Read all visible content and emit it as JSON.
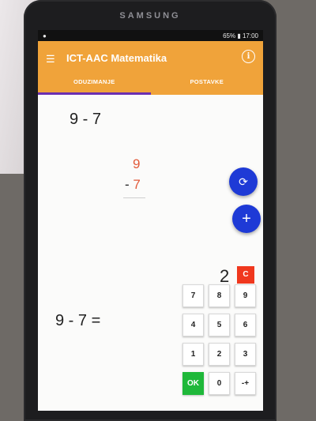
{
  "device": {
    "brand": "SAMSUNG"
  },
  "statusbar": {
    "battery": "65%",
    "time": "17:00"
  },
  "appbar": {
    "title": "ICT-AAC Matematika",
    "menu_icon": "hamburger-icon",
    "info_icon": "info-icon"
  },
  "tabs": [
    {
      "label": "ODUZIMANJE",
      "active": true
    },
    {
      "label": "POSTAVKE",
      "active": false
    }
  ],
  "task": {
    "top_expression": "9 - 7",
    "minuend": "9",
    "minus_sign": "- ",
    "subtrahend": "7",
    "bottom_expression": "9 - 7 ="
  },
  "answer": {
    "value": "2",
    "clear_label": "C"
  },
  "fabs": {
    "refresh_icon": "refresh-icon",
    "add_label": "+"
  },
  "keypad": {
    "keys": [
      "7",
      "8",
      "9",
      "4",
      "5",
      "6",
      "1",
      "2",
      "3",
      "OK",
      "0",
      "-+"
    ]
  },
  "colors": {
    "appbar": "#f0a33a",
    "fab": "#1e3ad6",
    "clear": "#f0381e",
    "ok": "#1fb83a",
    "accent_digit": "#e25a3a",
    "tab_indicator": "#6b2fb0"
  }
}
